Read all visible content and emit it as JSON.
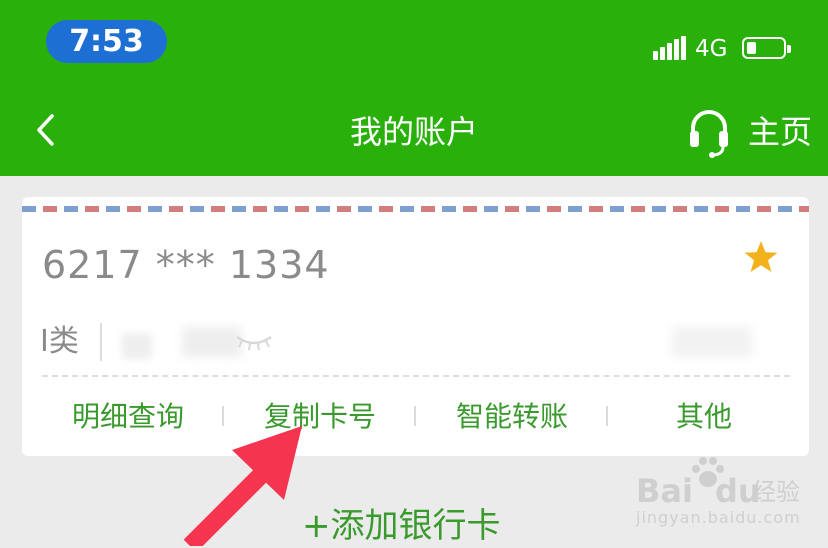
{
  "status_bar": {
    "time": "7:53",
    "network": "4G",
    "battery_level": 0.25,
    "icons": [
      "signal-icon",
      "battery-icon"
    ]
  },
  "nav": {
    "back_icon": "chevron-left-icon",
    "title": "我的账户",
    "service_icon": "headset-icon",
    "home_label": "主页"
  },
  "card": {
    "number": "6217 *** 1334",
    "favorite_icon": "star-icon",
    "type": "I类",
    "actions": [
      "明细查询",
      "复制卡号",
      "智能转账",
      "其他"
    ]
  },
  "add_card_label": "+添加银行卡",
  "watermark": {
    "brand_prefix": "Bai",
    "brand_suffix": "du",
    "sub": "经验",
    "url": "jingyan.baidu.com"
  },
  "colors": {
    "header_green": "#29b00b",
    "time_pill_blue": "#1e6fd4",
    "action_green": "#3a9a2e",
    "star_gold": "#f3b11b",
    "arrow_red": "#f5344f"
  }
}
